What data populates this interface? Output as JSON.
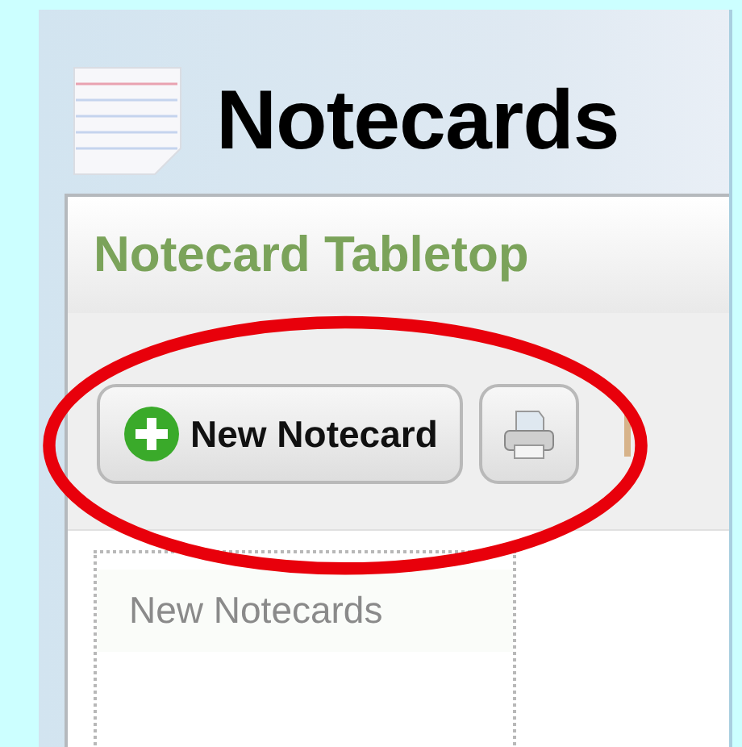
{
  "header": {
    "title": "Notecards"
  },
  "tabletop": {
    "title": "Notecard Tabletop",
    "toolbar": [
      {
        "kind": "new",
        "label": "New Notecard"
      },
      {
        "kind": "print"
      },
      {
        "kind": "separator"
      }
    ],
    "column": {
      "heading": "New Notecards"
    }
  },
  "annotation": {
    "kind": "ellipse"
  }
}
